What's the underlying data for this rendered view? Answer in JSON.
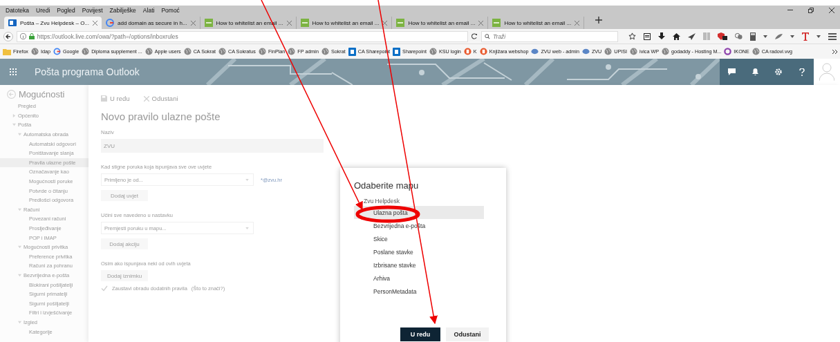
{
  "menu_bar": [
    "Datoteka",
    "Uredi",
    "Pogled",
    "Povijest",
    "Zabilješke",
    "Alati",
    "Pomoć"
  ],
  "tabs": [
    {
      "title": "Pošta – Zvu Helpdesk – O...",
      "kind": "outlook",
      "selected": true
    },
    {
      "title": "add domain as secure in h...",
      "kind": "google",
      "selected": false
    },
    {
      "title": "How to whitelist an email ...",
      "kind": "ogp",
      "selected": false
    },
    {
      "title": "How to whitelist an email ...",
      "kind": "ogp",
      "selected": false
    },
    {
      "title": "How to whitelist an email ...",
      "kind": "ogp",
      "selected": false
    },
    {
      "title": "How to whitelist an email ...",
      "kind": "ogp",
      "selected": false
    }
  ],
  "address_bar": {
    "url": "https://outlook.live.com/owa/?path=/options/inboxrules",
    "search_placeholder": "Traži"
  },
  "bookmarks": [
    {
      "label": "Firefox",
      "kind": "folder"
    },
    {
      "label": "Idap",
      "kind": "globe"
    },
    {
      "label": "Google",
      "kind": "google"
    },
    {
      "label": "Diploma supplement ...",
      "kind": "globe"
    },
    {
      "label": "Apple users",
      "kind": "globe"
    },
    {
      "label": "CA Sokrat",
      "kind": "globe"
    },
    {
      "label": "CA Sokratus",
      "kind": "globe"
    },
    {
      "label": "FinPlan",
      "kind": "globe"
    },
    {
      "label": "FP admin",
      "kind": "globe"
    },
    {
      "label": "Sokrat",
      "kind": "globe"
    },
    {
      "label": "CA Sharepoint",
      "kind": "sharepoint"
    },
    {
      "label": "Sharepoint",
      "kind": "sharepoint"
    },
    {
      "label": "KSU login",
      "kind": "globe"
    },
    {
      "label": "K",
      "kind": "shop"
    },
    {
      "label": "Knjižara webshop",
      "kind": "shop"
    },
    {
      "label": "ZVU web - admin",
      "kind": "zvu"
    },
    {
      "label": "ZVU",
      "kind": "zvu"
    },
    {
      "label": "UPISI",
      "kind": "globe"
    },
    {
      "label": "ivica WP",
      "kind": "globe"
    },
    {
      "label": "godaddy - Hosting M...",
      "kind": "globe"
    },
    {
      "label": "IKONE",
      "kind": "ring"
    },
    {
      "label": "CA radovi.vvg",
      "kind": "globe"
    }
  ],
  "app_header": {
    "title": "Pošta programa Outlook"
  },
  "sidebar": {
    "title": "Mogućnosti",
    "items": [
      {
        "label": "Pregled"
      },
      {
        "label": "Općenito",
        "expanded": false
      },
      {
        "label": "Pošta",
        "expanded": true,
        "children": [
          {
            "label": "Automatska obrada",
            "expanded": true,
            "children": [
              {
                "label": "Automatski odgovori",
                "selected": false
              },
              {
                "label": "Poništavanje slanja",
                "selected": false
              },
              {
                "label": "Pravila ulazne pošte",
                "selected": true
              },
              {
                "label": "Označavanje kao",
                "selected": false
              },
              {
                "label": "Mogućnosti poruke",
                "selected": false
              },
              {
                "label": "Potvrde o čitanju",
                "selected": false
              },
              {
                "label": "Predlošci odgovora",
                "selected": false
              }
            ]
          },
          {
            "label": "Računi",
            "expanded": true,
            "children": [
              {
                "label": "Povezani računi",
                "selected": false
              },
              {
                "label": "Prosljeđivanje",
                "selected": false
              },
              {
                "label": "POP i IMAP",
                "selected": false
              }
            ]
          },
          {
            "label": "Mogućnosti privitka",
            "expanded": true,
            "children": [
              {
                "label": "Preference privitka",
                "selected": false
              },
              {
                "label": "Računi za pohranu",
                "selected": false
              }
            ]
          },
          {
            "label": "Bezvrijedna e-pošta",
            "expanded": true,
            "children": [
              {
                "label": "Blokirani pošiljatelji",
                "selected": false
              },
              {
                "label": "Sigurni primatelji",
                "selected": false
              },
              {
                "label": "Sigurni pošiljatelji",
                "selected": false
              },
              {
                "label": "Filtri i izvješćivanje",
                "selected": false
              }
            ]
          },
          {
            "label": "Izgled",
            "expanded": true,
            "children": [
              {
                "label": "Kategorije",
                "selected": false
              }
            ]
          }
        ]
      }
    ]
  },
  "toolbar": {
    "save": "U redu",
    "cancel": "Odustani"
  },
  "form": {
    "title": "Novo pravilo ulazne pošte",
    "name_label": "Naziv",
    "name_value": "ZVU",
    "conditions_label": "Kad stigne poruka koja ispunjava sve ove uvjete",
    "condition_select": "Primljeno je od...",
    "condition_value": "*@zvu.hr",
    "add_condition": "Dodaj uvjet",
    "actions_label": "Učini sve navedeno u nastavku",
    "action_select": "Premjesti poruku u mapu...",
    "add_action": "Dodaj akciju",
    "exceptions_label": "Osim ako ispunjava neki od ovih uvjeta",
    "add_exception": "Dodaj iznimku",
    "stop_processing": {
      "label": "Zaustavi obradu dodatnih pravila",
      "checked": true
    },
    "help_link": "(Što to znači?)"
  },
  "dialog": {
    "title": "Odaberite mapu",
    "root": {
      "label": "Zvu Helpdesk"
    },
    "folders": [
      {
        "label": "Ulazna pošta",
        "selected": true
      },
      {
        "label": "Bezvrijedna e-pošta",
        "selected": false
      },
      {
        "label": "Skice",
        "selected": false
      },
      {
        "label": "Poslane stavke",
        "selected": false
      },
      {
        "label": "Izbrisane stavke",
        "selected": false
      },
      {
        "label": "Arhiva",
        "selected": false
      },
      {
        "label": "PersonMetadata",
        "selected": false
      }
    ],
    "ok": "U redu",
    "cancel": "Odustani"
  }
}
